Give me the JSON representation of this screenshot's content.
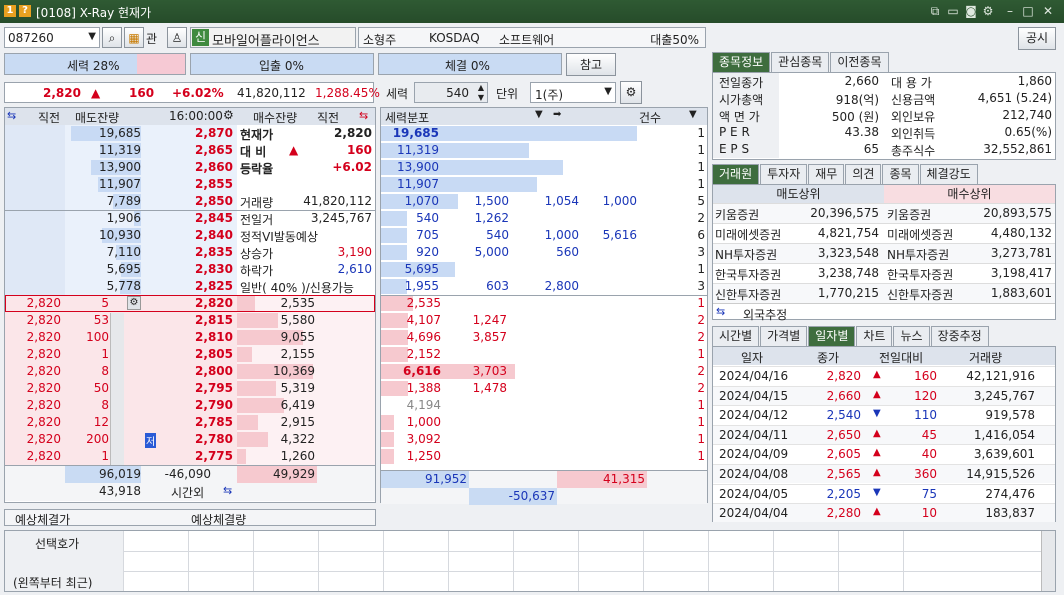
{
  "title": {
    "badge1": "1",
    "badge2": "?",
    "text": "[0108] X-Ray 현재가"
  },
  "toolbar": {
    "code": "087260",
    "label_gwan": "관",
    "badge_sin": "신",
    "stock_name": "모바일어플라이언스",
    "size": "소형주",
    "market": "KOSDAQ",
    "sector": "소프트웨어",
    "loan": "대출50%",
    "notice": "공시"
  },
  "power": {
    "force": "세력 28%",
    "entry": "입출 0%",
    "exec": "체결 0%",
    "ref": "참고"
  },
  "price_line": {
    "price": "2,820",
    "arrow": "▲",
    "change": "160",
    "rate": "+6.02%",
    "volume": "41,820,112",
    "vol_rate": "1,288.45%"
  },
  "ctrl": {
    "force_label": "세력",
    "force_val": "540",
    "unit_label": "단위",
    "unit_val": "1(주)"
  },
  "ob_header": {
    "prev": "직전",
    "sell_rem": "매도잔량",
    "time": "16:00:00",
    "buy_rem": "매수잔량",
    "prev2": "직전"
  },
  "asks": [
    {
      "rem": "19,685",
      "price": "2,870",
      "bar": 1.0
    },
    {
      "rem": "11,319",
      "price": "2,865",
      "bar": 0.58
    },
    {
      "rem": "13,900",
      "price": "2,860",
      "bar": 0.71
    },
    {
      "rem": "11,907",
      "price": "2,855",
      "bar": 0.61
    },
    {
      "rem": "7,789",
      "price": "2,850",
      "bar": 0.4
    },
    {
      "rem": "1,906",
      "price": "2,845",
      "bar": 0.1
    },
    {
      "rem": "10,930",
      "price": "2,840",
      "bar": 0.56
    },
    {
      "rem": "7,110",
      "price": "2,835",
      "bar": 0.36
    },
    {
      "rem": "5,695",
      "price": "2,830",
      "bar": 0.29
    },
    {
      "rem": "5,778",
      "price": "2,825",
      "bar": 0.3
    }
  ],
  "mid_info": [
    {
      "label": "현재가",
      "value": "2,820"
    },
    {
      "label": "대 비",
      "arrow": "▲",
      "value": "160"
    },
    {
      "label": "등락율",
      "value": "+6.02"
    },
    {
      "label": "",
      "value": ""
    },
    {
      "label": "거래량",
      "value": "41,820,112"
    },
    {
      "label": "전일거",
      "value": "3,245,767"
    },
    {
      "label": "정적VI발동예상",
      "value": ""
    },
    {
      "label": "상승가",
      "value": "3,190"
    },
    {
      "label": "하락가",
      "value": "2,610"
    },
    {
      "label": "일반( 40% )/신용가능",
      "value": ""
    }
  ],
  "bids": [
    {
      "prev": "2,820",
      "qty": "5",
      "price": "2,820",
      "rem": "2,535",
      "bar": 0.24
    },
    {
      "prev": "2,820",
      "qty": "53",
      "price": "2,815",
      "rem": "5,580",
      "bar": 0.54
    },
    {
      "prev": "2,820",
      "qty": "100",
      "price": "2,810",
      "rem": "9,055",
      "bar": 0.87
    },
    {
      "prev": "2,820",
      "qty": "1",
      "price": "2,805",
      "rem": "2,155",
      "bar": 0.2
    },
    {
      "prev": "2,820",
      "qty": "8",
      "price": "2,800",
      "rem": "10,369",
      "bar": 1.0
    },
    {
      "prev": "2,820",
      "qty": "50",
      "price": "2,795",
      "rem": "5,319",
      "bar": 0.51
    },
    {
      "prev": "2,820",
      "qty": "8",
      "price": "2,790",
      "rem": "6,419",
      "bar": 0.62
    },
    {
      "prev": "2,820",
      "qty": "12",
      "price": "2,785",
      "rem": "2,915",
      "bar": 0.28
    },
    {
      "prev": "2,820",
      "qty": "200",
      "price": "2,780",
      "rem": "4,322",
      "bar": 0.41,
      "tag": "저"
    },
    {
      "prev": "2,820",
      "qty": "1",
      "price": "2,775",
      "rem": "1,260",
      "bar": 0.12
    }
  ],
  "ob_footer": {
    "sell_total": "96,019",
    "diff": "-46,090",
    "buy_total": "49,929",
    "after_total": "43,918",
    "after_label": "시간외"
  },
  "expected": {
    "price_label": "예상체결가",
    "qty_label": "예상체결량"
  },
  "dist_header": {
    "title": "세력분포",
    "count": "건수"
  },
  "dist_asks": [
    {
      "v": [
        "19,685",
        "",
        "",
        ""
      ],
      "bar": 1.0,
      "cnt": "1"
    },
    {
      "v": [
        "11,319",
        "",
        "",
        ""
      ],
      "bar": 0.58,
      "cnt": "1"
    },
    {
      "v": [
        "13,900",
        "",
        "",
        ""
      ],
      "bar": 0.71,
      "cnt": "1"
    },
    {
      "v": [
        "11,907",
        "",
        "",
        ""
      ],
      "bar": 0.61,
      "cnt": "1"
    },
    {
      "v": [
        "1,070",
        "1,500",
        "1,054",
        "1,000"
      ],
      "bar": 0.3,
      "cnt": "5"
    },
    {
      "v": [
        "540",
        "1,262",
        "",
        ""
      ],
      "bar": 0.1,
      "cnt": "2"
    },
    {
      "v": [
        "705",
        "540",
        "1,000",
        "5,616"
      ],
      "bar": 0.1,
      "cnt": "6"
    },
    {
      "v": [
        "920",
        "5,000",
        "560",
        ""
      ],
      "bar": 0.1,
      "cnt": "3"
    },
    {
      "v": [
        "5,695",
        "",
        "",
        ""
      ],
      "bar": 0.29,
      "cnt": "1"
    },
    {
      "v": [
        "1,955",
        "603",
        "2,800",
        ""
      ],
      "bar": 0.1,
      "cnt": "3"
    }
  ],
  "dist_bids": [
    {
      "v": [
        "2,535",
        "",
        ""
      ],
      "bar": 0.24,
      "cnt": "1"
    },
    {
      "v": [
        "4,107",
        "1,247",
        ""
      ],
      "bar": 0.2,
      "cnt": "2"
    },
    {
      "v": [
        "4,696",
        "3,857",
        ""
      ],
      "bar": 0.2,
      "cnt": "2"
    },
    {
      "v": [
        "2,152",
        "",
        ""
      ],
      "bar": 0.2,
      "cnt": "1"
    },
    {
      "v": [
        "6,616",
        "3,703",
        ""
      ],
      "bar": 1.0,
      "cnt": "2"
    },
    {
      "v": [
        "1,388",
        "1,478",
        ""
      ],
      "bar": 0.2,
      "cnt": "2"
    },
    {
      "v": [
        "4,194",
        "",
        ""
      ],
      "bar": 0.0,
      "cnt": "1"
    },
    {
      "v": [
        "1,000",
        "",
        ""
      ],
      "bar": 0.1,
      "cnt": "1"
    },
    {
      "v": [
        "3,092",
        "",
        ""
      ],
      "bar": 0.1,
      "cnt": "1"
    },
    {
      "v": [
        "1,250",
        "",
        ""
      ],
      "bar": 0.1,
      "cnt": "1"
    }
  ],
  "dist_footer": {
    "ask_total": "91,952",
    "bid_total": "41,315",
    "diff": "-50,637"
  },
  "right_tabs1": [
    "종목정보",
    "관심종목",
    "이전종목"
  ],
  "stock_info": [
    [
      "전일종가",
      "2,660",
      "대 용 가",
      "1,860"
    ],
    [
      "시가총액",
      "918(억)",
      "신용금액",
      "4,651  (5.24)"
    ],
    [
      "액 면 가",
      "500 (원)",
      "외인보유",
      "212,740"
    ],
    [
      "P E R",
      "43.38",
      "외인취득",
      "0.65(%)"
    ],
    [
      "E P S",
      "65",
      "총주식수",
      "32,552,861"
    ]
  ],
  "right_tabs2": [
    "거래원",
    "투자자",
    "재무",
    "의견",
    "종목",
    "체결강도"
  ],
  "broker_head": {
    "sell": "매도상위",
    "buy": "매수상위"
  },
  "brokers": [
    [
      "키움증권",
      "20,396,575",
      "키움증권",
      "20,893,575"
    ],
    [
      "미래에셋증권",
      "4,821,754",
      "미래에셋증권",
      "4,480,132"
    ],
    [
      "NH투자증권",
      "3,323,548",
      "NH투자증권",
      "3,273,781"
    ],
    [
      "한국투자증권",
      "3,238,748",
      "한국투자증권",
      "3,198,417"
    ],
    [
      "신한투자증권",
      "1,770,215",
      "신한투자증권",
      "1,883,601"
    ]
  ],
  "foreign_est": "외국추정",
  "right_tabs3": [
    "시간별",
    "가격별",
    "일자별",
    "차트",
    "뉴스",
    "장중추정"
  ],
  "daily_head": [
    "일자",
    "종가",
    "전일대비",
    "거래량"
  ],
  "daily": [
    {
      "date": "2024/04/16",
      "close": "2,820",
      "dir": "up",
      "chg": "160",
      "vol": "42,121,916"
    },
    {
      "date": "2024/04/15",
      "close": "2,660",
      "dir": "up",
      "chg": "120",
      "vol": "3,245,767"
    },
    {
      "date": "2024/04/12",
      "close": "2,540",
      "dir": "down",
      "chg": "110",
      "vol": "919,578"
    },
    {
      "date": "2024/04/11",
      "close": "2,650",
      "dir": "up",
      "chg": "45",
      "vol": "1,416,054"
    },
    {
      "date": "2024/04/09",
      "close": "2,605",
      "dir": "up",
      "chg": "40",
      "vol": "3,639,601"
    },
    {
      "date": "2024/04/08",
      "close": "2,565",
      "dir": "up",
      "chg": "360",
      "vol": "14,915,526"
    },
    {
      "date": "2024/04/05",
      "close": "2,205",
      "dir": "down",
      "chg": "75",
      "vol": "274,476"
    },
    {
      "date": "2024/04/04",
      "close": "2,280",
      "dir": "up",
      "chg": "10",
      "vol": "183,837"
    }
  ],
  "bottom": {
    "label1": "선택호가",
    "label2": "(왼쪽부터 최근)"
  }
}
